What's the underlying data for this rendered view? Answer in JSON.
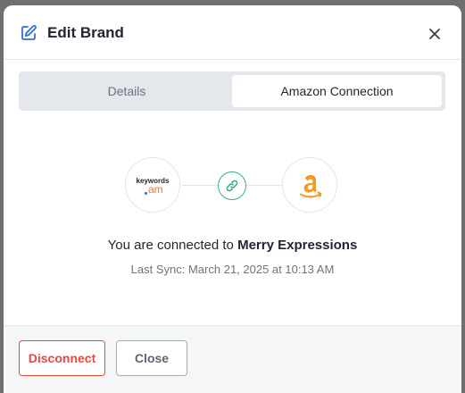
{
  "modal": {
    "title": "Edit Brand"
  },
  "tabs": [
    {
      "label": "Details",
      "active": false
    },
    {
      "label": "Amazon Connection",
      "active": true
    }
  ],
  "connection": {
    "left_logo": {
      "line1": "keywords",
      "line2": "am"
    },
    "status_prefix": "You are connected to ",
    "brand_name": "Merry Expressions",
    "last_sync": "Last Sync: March 21, 2025 at 10:13 AM"
  },
  "footer": {
    "disconnect_label": "Disconnect",
    "close_label": "Close"
  },
  "icons": {
    "edit": "edit-icon",
    "close": "close-icon",
    "link": "link-icon",
    "amazon": "amazon-logo-icon"
  },
  "colors": {
    "accent_blue": "#2f6fd6",
    "link_green": "#3ab07a",
    "danger_red": "#e5483d",
    "amazon_orange": "#f39a1f",
    "keywords_orange": "#f0762c"
  }
}
